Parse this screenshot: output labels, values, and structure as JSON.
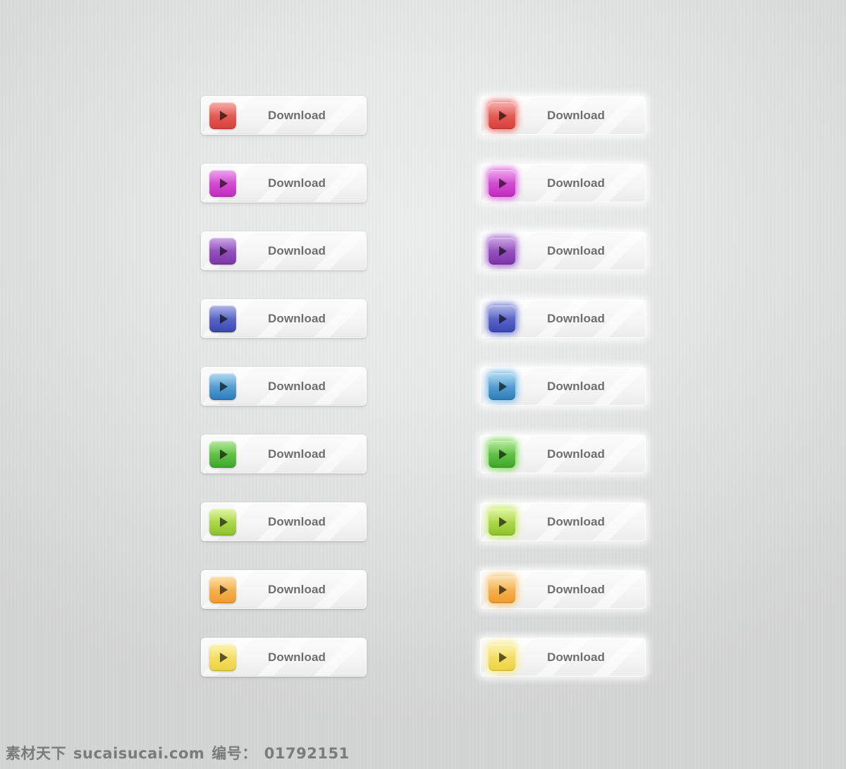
{
  "page": {
    "background_top": "#ececed",
    "background_bottom": "#d3d4d4",
    "label_color": "#6d6d6d",
    "button_face_top": "#fbfbfb",
    "button_face_bottom": "#ececec"
  },
  "columns": [
    {
      "name": "left-column",
      "style": "flat-shadow"
    },
    {
      "name": "right-column",
      "style": "glow"
    }
  ],
  "buttons": [
    {
      "id": "download-red",
      "color_name": "red",
      "label": "Download",
      "icon": "play-icon",
      "icon_top": "#f07a74",
      "icon_bottom": "#d63f38",
      "glow": "#f2645c"
    },
    {
      "id": "download-magenta",
      "color_name": "magenta",
      "label": "Download",
      "icon": "play-icon",
      "icon_top": "#e06de0",
      "icon_bottom": "#c22bbf",
      "glow": "#e44fe0"
    },
    {
      "id": "download-purple",
      "color_name": "purple",
      "label": "Download",
      "icon": "play-icon",
      "icon_top": "#ab6fd3",
      "icon_bottom": "#7c33a8",
      "glow": "#a css"
    },
    {
      "id": "download-indigo",
      "color_name": "indigo",
      "label": "Download",
      "icon": "play-icon",
      "icon_top": "#7b86d8",
      "icon_bottom": "#3a46b4",
      "glow": "#6b78e0"
    },
    {
      "id": "download-blue",
      "color_name": "blue",
      "label": "Download",
      "icon": "play-icon",
      "icon_top": "#7fc0e8",
      "icon_bottom": "#2c7cb8",
      "glow": "#56a8e6"
    },
    {
      "id": "download-green",
      "color_name": "green",
      "label": "Download",
      "icon": "play-icon",
      "icon_top": "#86dd62",
      "icon_bottom": "#3da62c",
      "glow": "#6ed14a"
    },
    {
      "id": "download-lime",
      "color_name": "lime",
      "label": "Download",
      "icon": "play-icon",
      "icon_top": "#ccee6e",
      "icon_bottom": "#8dc12a",
      "glow": "#b6e052"
    },
    {
      "id": "download-orange",
      "color_name": "orange",
      "label": "Download",
      "icon": "play-icon",
      "icon_top": "#fbcb77",
      "icon_bottom": "#ef9a2c",
      "glow": "#f9b950"
    },
    {
      "id": "download-yellow",
      "color_name": "yellow",
      "label": "Download",
      "icon": "play-icon",
      "icon_top": "#fbec86",
      "icon_bottom": "#edd141",
      "glow": "#f7e35e"
    }
  ],
  "watermark": {
    "site_cn": "素材天下",
    "site_url": "sucaisucai.com",
    "id_label": "编号：",
    "id_value": "01792151"
  }
}
